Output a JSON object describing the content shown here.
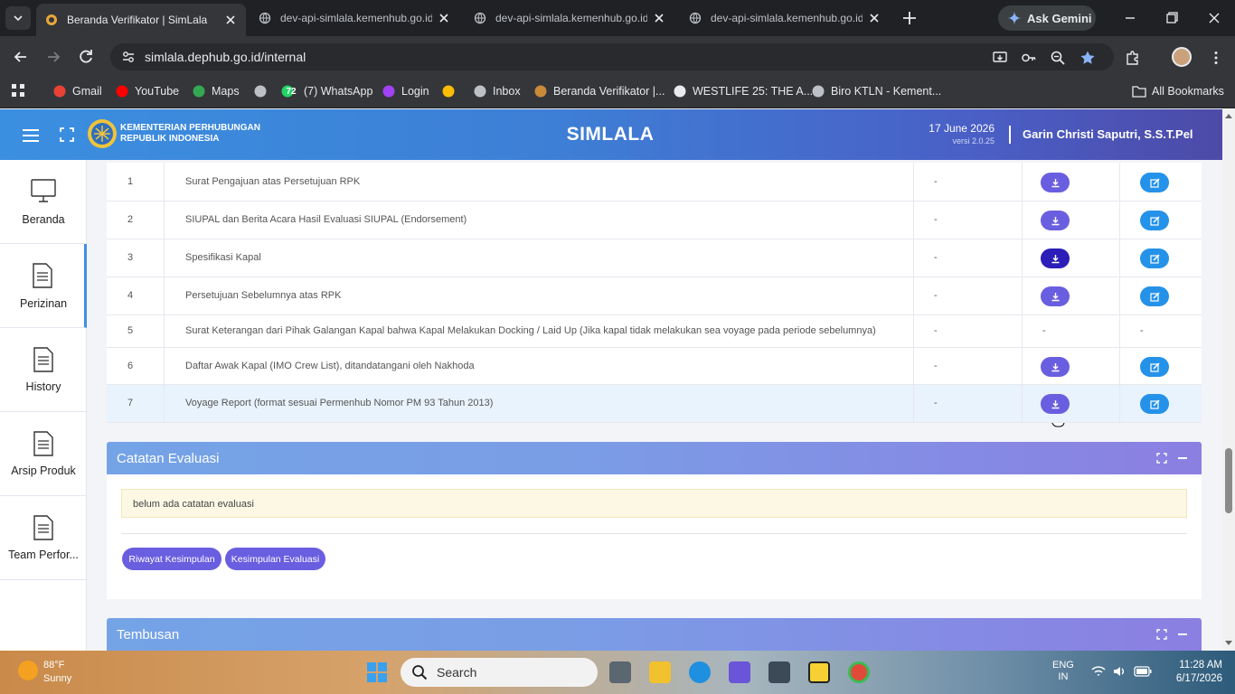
{
  "browser": {
    "tabs": [
      {
        "label": "Beranda Verifikator | SimLala",
        "active": true
      },
      {
        "label": "dev-api-simlala.kemenhub.go.id",
        "active": false
      },
      {
        "label": "dev-api-simlala.kemenhub.go.id",
        "active": false
      },
      {
        "label": "dev-api-simlala.kemenhub.go.id",
        "active": false
      }
    ],
    "gemini_label": "Ask Gemini",
    "url": "simlala.dephub.go.id/internal",
    "bookmarks": [
      {
        "label": "Gmail",
        "icon": "gmail-icon"
      },
      {
        "label": "YouTube",
        "icon": "youtube-icon"
      },
      {
        "label": "Maps",
        "icon": "maps-icon"
      },
      {
        "label": "",
        "icon": "globe-icon"
      },
      {
        "label": "(7) WhatsApp",
        "icon": "whatsapp-icon",
        "badge": "72"
      },
      {
        "label": "Login",
        "icon": "login-icon"
      },
      {
        "label": "",
        "icon": "pinwheel-icon"
      },
      {
        "label": "Inbox",
        "icon": "inbox-icon"
      },
      {
        "label": "Beranda Verifikator |...",
        "icon": "simlala-icon"
      },
      {
        "label": "WESTLIFE 25: THE A...",
        "icon": "page-icon"
      },
      {
        "label": "Biro KTLN - Kement...",
        "icon": "globe-icon"
      }
    ],
    "all_bookmarks": "All Bookmarks"
  },
  "header": {
    "org_line1": "KEMENTERIAN PERHUBUNGAN",
    "org_line2": "REPUBLIK INDONESIA",
    "app_title": "SIMLALA",
    "date": "17 June 2026",
    "version": "versi 2.0.25",
    "user": "Garin Christi Saputri, S.S.T.Pel"
  },
  "sidebar": {
    "items": [
      {
        "label": "Beranda",
        "icon": "monitor-icon"
      },
      {
        "label": "Perizinan",
        "icon": "document-icon",
        "active": true
      },
      {
        "label": "History",
        "icon": "document-icon"
      },
      {
        "label": "Arsip Produk",
        "icon": "document-icon"
      },
      {
        "label": "Team Performance",
        "display": "Team Perfor...",
        "icon": "document-icon"
      }
    ]
  },
  "documents": {
    "rows": [
      {
        "no": "1",
        "name": "Surat Pengajuan atas Persetujuan RPK",
        "status": "-",
        "download": true,
        "edit": true
      },
      {
        "no": "2",
        "name": "SIUPAL dan Berita Acara Hasil Evaluasi SIUPAL (Endorsement)",
        "status": "-",
        "download": true,
        "edit": true
      },
      {
        "no": "3",
        "name": "Spesifikasi Kapal",
        "status": "-",
        "download": true,
        "edit": true
      },
      {
        "no": "4",
        "name": "Persetujuan Sebelumnya atas RPK",
        "status": "-",
        "download": true,
        "edit": true
      },
      {
        "no": "5",
        "name": "Surat Keterangan dari Pihak Galangan Kapal bahwa Kapal Melakukan Docking / Laid Up (Jika kapal tidak melakukan sea voyage pada periode sebelumnya)",
        "status": "-",
        "download": false,
        "edit": false,
        "download_text": "-",
        "edit_text": "-"
      },
      {
        "no": "6",
        "name": "Daftar Awak Kapal (IMO Crew List), ditandatangani oleh Nakhoda",
        "status": "-",
        "download": true,
        "edit": true
      },
      {
        "no": "7",
        "name": "Voyage Report (format sesuai Permenhub Nomor PM 93 Tahun 2013)",
        "status": "-",
        "download": true,
        "edit": true
      }
    ]
  },
  "evaluation": {
    "title": "Catatan Evaluasi",
    "note": "belum ada catatan evaluasi",
    "button_history": "Riwayat Kesimpulan",
    "button_conclusion": "Kesimpulan Evaluasi"
  },
  "tembusan": {
    "title": "Tembusan"
  },
  "taskbar": {
    "temperature": "88°F",
    "condition": "Sunny",
    "search_placeholder": "Search",
    "lang1": "ENG",
    "lang2": "IN",
    "time": "11:28 AM",
    "date": "6/17/2026"
  },
  "colors": {
    "header_start": "#3b8fe0",
    "header_end": "#4d4aa8",
    "download_button": "#6a5ee0",
    "download_button_active": "#2b1fb7",
    "edit_button": "#2592e9",
    "panel_header": "#74a3e6"
  }
}
